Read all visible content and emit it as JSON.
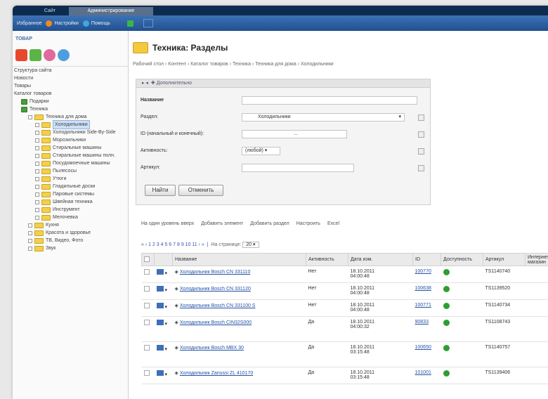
{
  "top_tabs": [
    "Сайт",
    "Администрирование"
  ],
  "toolbar": {
    "items": [
      "Избранное",
      "Настройки",
      "Помощь"
    ],
    "colors": {
      "settings": "#f08a1d",
      "help": "#3ea6e0",
      "green": "#39b54a"
    }
  },
  "sidebar": {
    "header": "ТОВАР",
    "items": [
      {
        "label": "Структура сайта",
        "level": 0
      },
      {
        "label": "Новости",
        "level": 0
      },
      {
        "label": "Товары",
        "level": 0
      },
      {
        "label": "Каталог товаров",
        "level": 0
      },
      {
        "label": "Подарки",
        "level": 1
      },
      {
        "label": "Техника",
        "level": 1
      },
      {
        "label": "Техника для дома",
        "level": 2
      },
      {
        "label": "Холодильники",
        "level": 3,
        "selected": true
      },
      {
        "label": "Холодильники Side-By-Side",
        "level": 3
      },
      {
        "label": "Морозильники",
        "level": 3
      },
      {
        "label": "Стиральные машины",
        "level": 3
      },
      {
        "label": "Стиральные машины полн.",
        "level": 3
      },
      {
        "label": "Посудомоечные машины",
        "level": 3
      },
      {
        "label": "Пылесосы",
        "level": 3
      },
      {
        "label": "Утюги",
        "level": 3
      },
      {
        "label": "Гладильные доски",
        "level": 3
      },
      {
        "label": "Паровые системы",
        "level": 3
      },
      {
        "label": "Швейная техника",
        "level": 3
      },
      {
        "label": "Инструмент",
        "level": 3
      },
      {
        "label": "Мелочевка",
        "level": 3
      },
      {
        "label": "Кухня",
        "level": 2
      },
      {
        "label": "Красота и здоровье",
        "level": 2
      },
      {
        "label": "ТВ, Видео, Фото",
        "level": 2
      },
      {
        "label": "Звук",
        "level": 2
      }
    ]
  },
  "page": {
    "title": "Техника: Разделы",
    "breadcrumb": "Рабочий стол › Контент › Каталог товаров › Техника › Техника для дома › Холодильники"
  },
  "filter": {
    "bar_label": "Дополнительно",
    "name_label": "Название",
    "section_label": "Раздел:",
    "section_value": "Холодильники",
    "id_label": "ID (начальный и конечный):",
    "id_separator": "...",
    "active_label": "Активность:",
    "active_value": "(любой)",
    "article_label": "Артикул:",
    "find_button": "Найти",
    "cancel_button": "Отменить"
  },
  "actions": [
    "На один уровень вверх",
    "Добавить элемент",
    "Добавить раздел",
    "Настроить",
    "Excel"
  ],
  "pager": {
    "per_page_label": "На странице:",
    "per_page_value": "20"
  },
  "table": {
    "headers": [
      "Название",
      "Активность",
      "Дата изм.",
      "ID",
      "Доступность",
      "Артикул",
      "Интернет-магазин"
    ],
    "rows": [
      {
        "name": "Холодильник Bosch CN 331110",
        "active": "Нет",
        "date": "18.10.2011",
        "time": "04:00:48",
        "id": "100770",
        "article": "TS1140740"
      },
      {
        "name": "Холодильник Bosch CN 331120",
        "active": "Нет",
        "date": "18.10.2011",
        "time": "04:00:48",
        "id": "100638",
        "article": "TS1139520"
      },
      {
        "name": "Холодильник Bosch CN 331100 S",
        "active": "Нет",
        "date": "18.10.2011",
        "time": "04:00:48",
        "id": "100771",
        "article": "TS1140734"
      },
      {
        "name": "Холодильник Bosch CIN32S000",
        "active": "Да",
        "date": "18.10.2011",
        "time": "04:00:32",
        "id": "90833",
        "article": "TS1108743"
      },
      {
        "name": "Холодильник Bosch MBX 30",
        "active": "Да",
        "date": "18.10.2011",
        "time": "03:15:48",
        "id": "100650",
        "article": "TS1140757"
      },
      {
        "name": "Холодильник Zanussi ZL 410170",
        "active": "Да",
        "date": "18.10.2011",
        "time": "03:15:48",
        "id": "101001",
        "article": "TS1139406"
      }
    ]
  }
}
